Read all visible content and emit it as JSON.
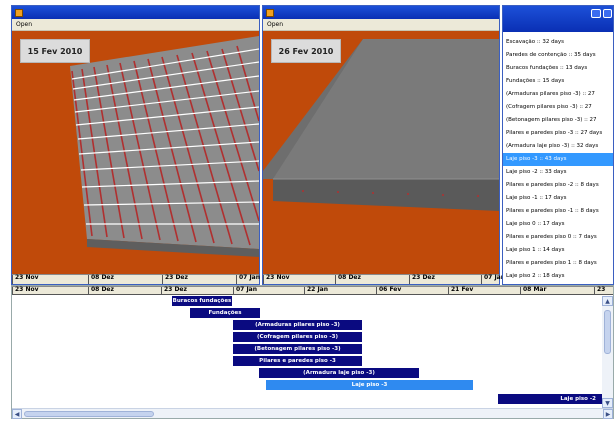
{
  "window1": {
    "menu": "Open",
    "date_label": "15 Fev 2010"
  },
  "window2": {
    "menu": "Open",
    "date_label": "26 Fev 2010"
  },
  "left_ruler": [
    "23 Nov",
    "08 Dez",
    "23 Dez",
    "07 Jan"
  ],
  "mid_ruler": [
    "23 Nov",
    "08 Dez",
    "23 Dez",
    "07 Jan"
  ],
  "timeline_ruler": [
    "23 Nov",
    "08 Dez",
    "23 Dez",
    "07 Jan",
    "22 Jan",
    "06 Fev",
    "21 Fev",
    "08 Mar",
    "23"
  ],
  "task_list": [
    "Escavação :: 32 days",
    "Paredes de contenção :: 35 days",
    "Buracos fundações :: 13 days",
    "Fundações :: 15 days",
    "(Armaduras pilares piso -3) :: 27",
    "(Cofragem pilares piso -3) :: 27",
    "(Betonagem pilares piso -3) :: 27",
    "Pilares e paredes piso -3 :: 27 days",
    "(Armadura laje piso -3) :: 32 days",
    "Laje piso -3 :: 43 days",
    "Laje piso -2 :: 33 days",
    "Pilares e paredes piso -2 :: 8 days",
    "Laje piso -1 :: 17 days",
    "Pilares e paredes piso -1 :: 8 days",
    "Laje piso 0 :: 17 days",
    "Pilares e paredes piso 0 :: 7 days",
    "Laje piso 1 :: 14 days",
    "Pilares e paredes piso 1 :: 8 days",
    "Laje piso 2 :: 18 days"
  ],
  "selected_task_index": 9,
  "gantt_bars": [
    "Buracos fundações",
    "Fundações",
    "(Armaduras pilares piso -3)",
    "(Cofragem pilares piso -3)",
    "(Betonagem pilares piso -3)",
    "Pilares e paredes piso -3",
    "(Armadura laje piso -3)",
    "Laje piso -3",
    "Laje piso -2"
  ],
  "scroll": {
    "up": "▲",
    "down": "▼",
    "left": "◀",
    "right": "▶"
  },
  "colors": {
    "titlebar": "#0a2fb4",
    "ground": "#c04a0a",
    "bar": "#0a0a80",
    "selected": "#2f8af0"
  }
}
